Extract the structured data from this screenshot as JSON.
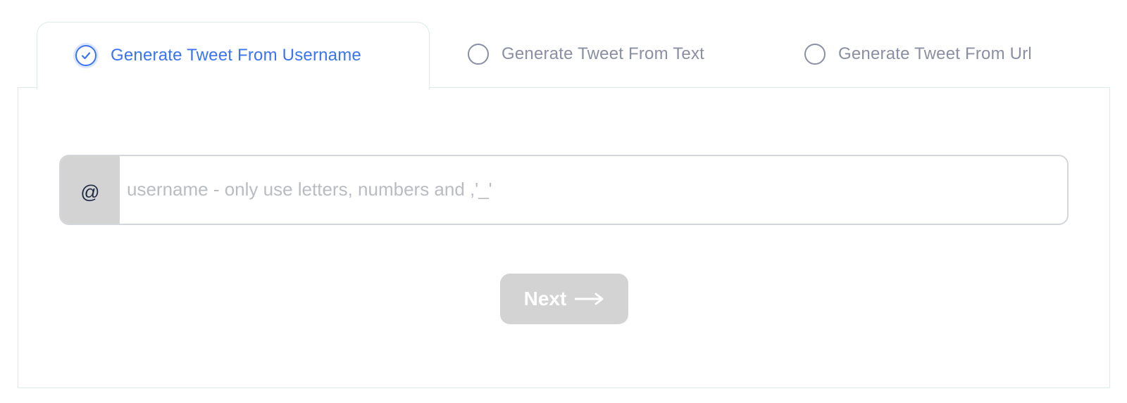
{
  "tabs": [
    {
      "label": "Generate Tweet From Username",
      "selected": true
    },
    {
      "label": "Generate Tweet From Text",
      "selected": false
    },
    {
      "label": "Generate Tweet From Url",
      "selected": false
    }
  ],
  "form": {
    "prefix": "@",
    "username_placeholder": "username - only use letters, numbers and ,'_'",
    "username_value": "",
    "next_label": "Next"
  },
  "icons": {
    "selected_radio": "check-circle-icon",
    "unselected_radio": "radio-empty-icon",
    "next_arrow": "arrow-right-icon"
  },
  "colors": {
    "accent": "#3b74f2",
    "inactive_text": "#8a8fa3",
    "button_disabled": "#d3d3d3",
    "panel_border": "#dcebe6"
  }
}
